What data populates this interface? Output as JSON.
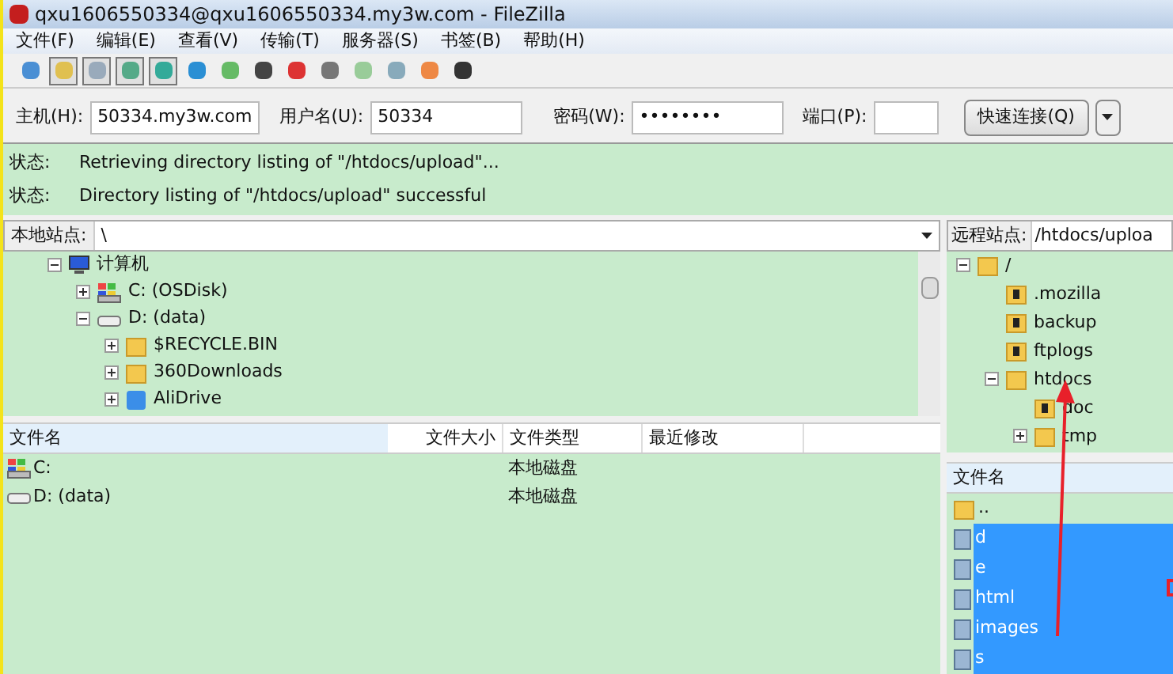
{
  "window": {
    "title": "qxu1606550334@qxu1606550334.my3w.com - FileZilla"
  },
  "menu": [
    "文件(F)",
    "编辑(E)",
    "查看(V)",
    "传输(T)",
    "服务器(S)",
    "书签(B)",
    "帮助(H)"
  ],
  "toolbar": [
    {
      "pressed": false
    },
    {
      "pressed": true
    },
    {
      "pressed": true
    },
    {
      "pressed": true
    },
    {
      "pressed": true
    },
    {
      "pressed": false
    },
    {
      "pressed": false
    },
    {
      "pressed": false
    },
    {
      "pressed": false
    },
    {
      "pressed": false
    },
    {
      "pressed": false
    },
    {
      "pressed": false
    },
    {
      "pressed": false
    },
    {
      "pressed": false
    }
  ],
  "quickconnect": {
    "host_label": "主机(H):",
    "host": "50334.my3w.com",
    "user_label": "用户名(U):",
    "user": "50334",
    "password_label": "密码(W):",
    "password": "••••••••",
    "port_label": "端口(P):",
    "button": "快速连接(Q)"
  },
  "log": [
    {
      "label": "状态:",
      "message": "Retrieving directory listing of \"/htdocs/upload\"..."
    },
    {
      "label": "状态:",
      "message": "Directory listing of \"/htdocs/upload\" successful"
    }
  ],
  "local": {
    "site_label": "本地站点:",
    "path": "\\",
    "tree": [
      {
        "name": "计算机",
        "kind": "computer",
        "expanded": true,
        "children": [
          {
            "name": "C: (OSDisk)",
            "kind": "osdisk",
            "expanded": false
          },
          {
            "name": "D: (data)",
            "kind": "drive",
            "expanded": true,
            "children": [
              {
                "name": "$RECYCLE.BIN",
                "kind": "folder",
                "expanded": false
              },
              {
                "name": "360Downloads",
                "kind": "folder",
                "expanded": false
              },
              {
                "name": "AliDrive",
                "kind": "app",
                "expanded": false
              }
            ]
          }
        ]
      }
    ],
    "columns": [
      "文件名",
      "文件大小",
      "文件类型",
      "最近修改"
    ],
    "rows": [
      {
        "name": "C:",
        "kind": "osdisk",
        "size": "",
        "type": "本地磁盘",
        "modified": ""
      },
      {
        "name": "D: (data)",
        "kind": "drive",
        "size": "",
        "type": "本地磁盘",
        "modified": ""
      }
    ]
  },
  "remote": {
    "site_label": "远程站点:",
    "path": "/htdocs/uploa",
    "tree": [
      {
        "name": "/",
        "kind": "folder",
        "expanded": true,
        "children": [
          {
            "name": ".mozilla",
            "kind": "unknown"
          },
          {
            "name": "backup",
            "kind": "unknown"
          },
          {
            "name": "ftplogs",
            "kind": "unknown"
          },
          {
            "name": "htdocs",
            "kind": "folder",
            "expanded": true,
            "children": [
              {
                "name": "doc",
                "kind": "unknown"
              },
              {
                "name": "tmp",
                "kind": "folder",
                "expanded": false
              }
            ]
          }
        ]
      }
    ],
    "columns": [
      "文件名"
    ],
    "rows": [
      {
        "name": "..",
        "kind": "folder",
        "selected": false
      },
      {
        "name": "d",
        "kind": "folder",
        "selected": true
      },
      {
        "name": "e",
        "kind": "folder",
        "selected": true
      },
      {
        "name": "html",
        "kind": "folder",
        "selected": true
      },
      {
        "name": "images",
        "kind": "folder",
        "selected": true
      },
      {
        "name": "s",
        "kind": "folder",
        "selected": true
      }
    ]
  }
}
